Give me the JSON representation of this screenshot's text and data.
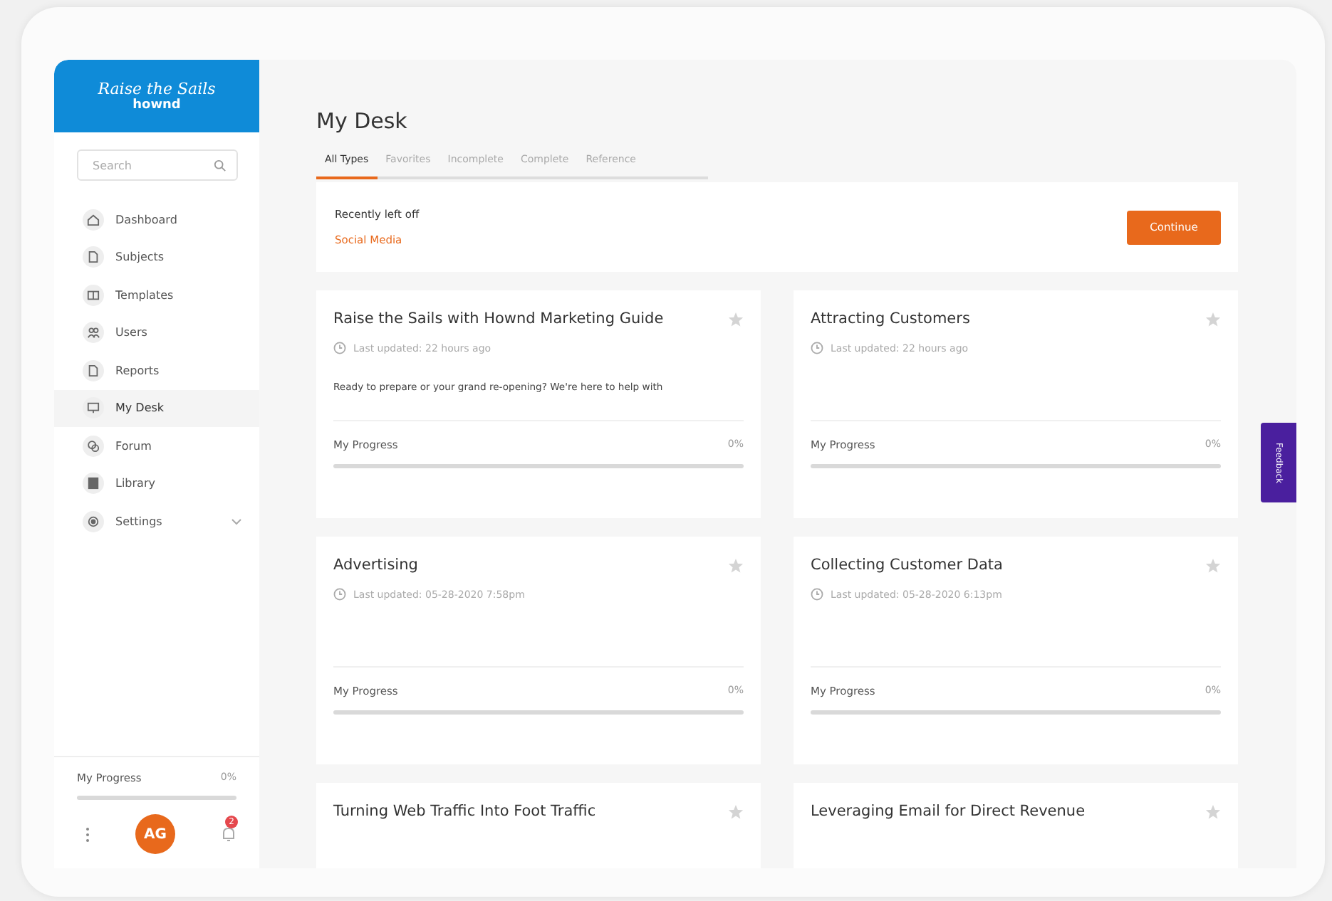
{
  "brand": {
    "script": "Raise the Sails",
    "name": "hownd"
  },
  "search": {
    "placeholder": "Search"
  },
  "nav": [
    {
      "label": "Dashboard",
      "selected": false
    },
    {
      "label": "Subjects",
      "selected": false
    },
    {
      "label": "Templates",
      "selected": false
    },
    {
      "label": "Users",
      "selected": false
    },
    {
      "label": "Reports",
      "selected": false
    },
    {
      "label": "My Desk",
      "selected": true
    },
    {
      "label": "Forum",
      "selected": false
    },
    {
      "label": "Library",
      "selected": false
    },
    {
      "label": "Settings",
      "selected": false,
      "expandable": true
    }
  ],
  "sidebar_progress": {
    "label": "My Progress",
    "reading": "0%",
    "level": 0
  },
  "user": {
    "initials": "AG",
    "notifications": "2"
  },
  "page_title": "My Desk",
  "tabs": [
    {
      "label": "All Types",
      "selected": true
    },
    {
      "label": "Favorites",
      "selected": false
    },
    {
      "label": "Incomplete",
      "selected": false
    },
    {
      "label": "Complete",
      "selected": false
    },
    {
      "label": "Reference",
      "selected": false
    }
  ],
  "recent": {
    "label": "Recently left off",
    "link": "Social Media",
    "button": "Continue"
  },
  "cards": [
    {
      "title": "Raise the Sails with Hownd Marketing Guide",
      "updated": "Last updated: 22 hours ago",
      "description": "Ready to prepare or your grand re-opening? We're here to help with",
      "progress_label": "My Progress",
      "reading": "0%",
      "level": 0,
      "favorite": false
    },
    {
      "title": "Attracting Customers",
      "updated": "Last updated: 22 hours ago",
      "progress_label": "My Progress",
      "reading": "0%",
      "level": 0,
      "favorite": false
    },
    {
      "title": "Advertising",
      "updated": "Last updated: 05-28-2020 7:58pm",
      "progress_label": "My Progress",
      "reading": "0%",
      "level": 0,
      "favorite": false
    },
    {
      "title": "Collecting Customer Data",
      "updated": "Last updated: 05-28-2020 6:13pm",
      "progress_label": "My Progress",
      "reading": "0%",
      "level": 0,
      "favorite": false
    },
    {
      "title": "Turning Web Traffic Into Foot Traffic",
      "favorite": false
    },
    {
      "title": "Leveraging Email for Direct Revenue",
      "favorite": false
    }
  ],
  "feedback": "Feedback"
}
